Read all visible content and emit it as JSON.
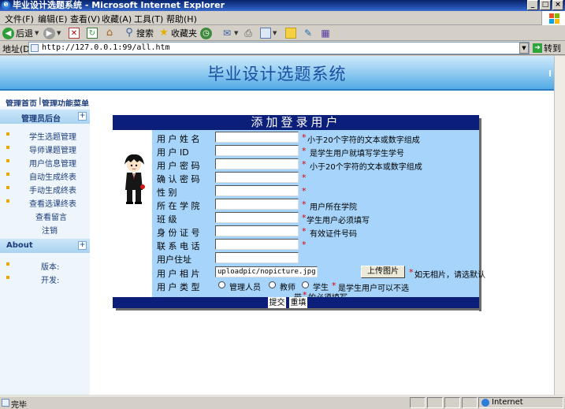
{
  "window": {
    "title": "毕业设计选题系统 - Microsoft Internet Explorer"
  },
  "menu": [
    "文件(F)",
    "编辑(E)",
    "查看(V)",
    "收藏(A)",
    "工具(T)",
    "帮助(H)"
  ],
  "toolbar": {
    "back": "后退",
    "search": "搜索",
    "favorites": "收藏夹"
  },
  "address": {
    "label": "地址(D)",
    "url": "http://127.0.0.1:99/all.htm",
    "go": "转到"
  },
  "page": {
    "banner_title": "毕业设计选题系统",
    "top_links": {
      "home": "管理首页",
      "sep": "|",
      "menu": "管理功能菜单"
    },
    "sidebar": {
      "admin_head": "管理员后台",
      "items": [
        "学生选题管理",
        "导师课题管理",
        "用户信息管理",
        "自动生成终表",
        "手动生成终表",
        "查看选课终表",
        "查看留言",
        "注销"
      ],
      "about_head": "About",
      "about_items": [
        "版本:",
        "开发:"
      ],
      "toggle": "+"
    },
    "form": {
      "title": "添加登录用户",
      "fields": [
        {
          "label": "用 户 姓 名",
          "value": "",
          "star": "*",
          "note": "小于20个字符的文本或数字组成"
        },
        {
          "label": "用 户 ID",
          "value": "",
          "star": "*",
          "note": "是学生用户就填写学生学号"
        },
        {
          "label": "用 户 密 码",
          "value": "",
          "star": "*",
          "note": "小于20个字符的文本或数字组成"
        },
        {
          "label": "确 认 密 码",
          "value": "",
          "star": "*",
          "note": ""
        },
        {
          "label": "性 别",
          "value": "",
          "star": "*",
          "note": ""
        },
        {
          "label": "所 在 学 院",
          "value": "",
          "star": "*",
          "note": "用户所在学院"
        },
        {
          "label": "班 级",
          "value": "",
          "star": "*",
          "note": "学生用户必须填写"
        },
        {
          "label": "身 份 证 号",
          "value": "",
          "star": "*",
          "note": "有效证件号码"
        },
        {
          "label": "联 系 电 话",
          "value": "",
          "star": "*",
          "note": ""
        },
        {
          "label": "用户住址",
          "value": "",
          "star": "",
          "note": ""
        }
      ],
      "photo": {
        "label": "用 户 相 片",
        "value": "uploadpic/nopicture.jpg",
        "button": "上传图片",
        "star": "*",
        "note": "如无相片，请选默认"
      },
      "type": {
        "label": "用 户 类 型",
        "options": [
          "管理人员",
          "教师",
          "学生"
        ],
        "star": "*",
        "note": "是学生用户可以不选",
        "note2_pre": "带",
        "note2_star": "*",
        "note2_post": "的必须填写"
      },
      "submit": "提交",
      "reset": "重填"
    }
  },
  "status": {
    "text": "完毕",
    "zone": "Internet"
  }
}
